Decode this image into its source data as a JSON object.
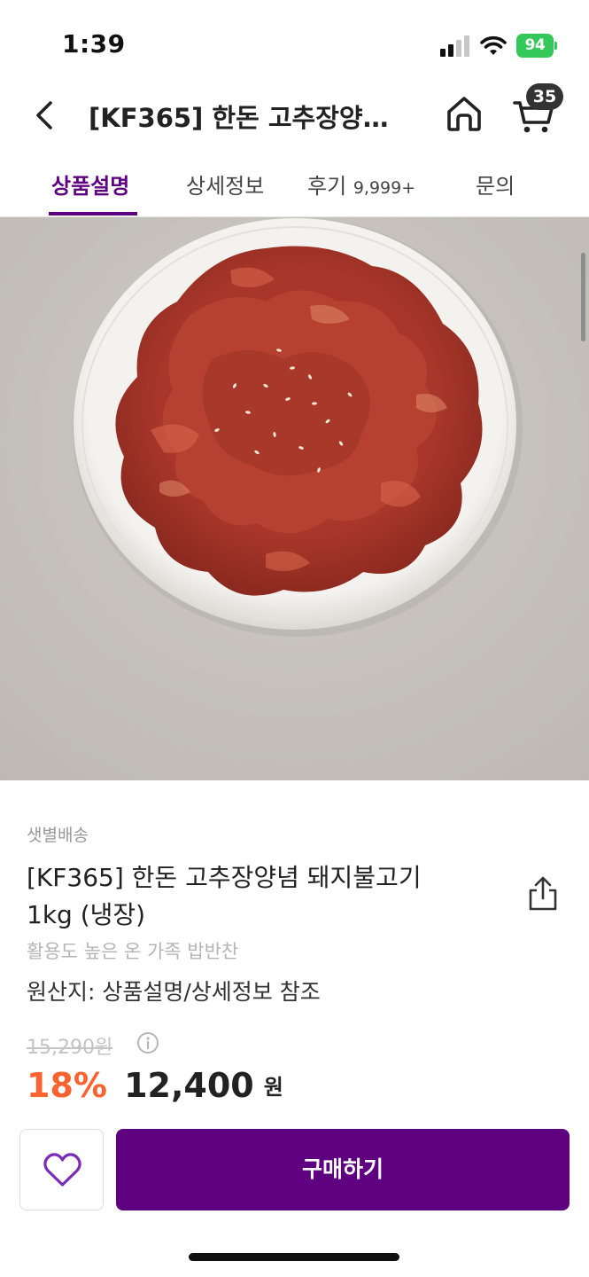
{
  "status_bar": {
    "time": "1:39",
    "battery": "94"
  },
  "header": {
    "title": "[KF365] 한돈 고추장양념 돼지불고기 1kg (냉장)",
    "cart_count": "35",
    "icons": [
      "chevron-left-icon",
      "home-icon",
      "cart-icon"
    ]
  },
  "tabs": [
    {
      "label": "상품설명",
      "count": "",
      "active": true
    },
    {
      "label": "상세정보",
      "count": "",
      "active": false
    },
    {
      "label": "후기",
      "count": "9,999+",
      "active": false
    },
    {
      "label": "문의",
      "count": "",
      "active": false
    }
  ],
  "product": {
    "delivery": "샛별배송",
    "name_line1": "[KF365] 한돈 고추장양념 돼지불고기",
    "name_line2": "1kg (냉장)",
    "subtitle": "활용도 높은 온 가족 밥반찬",
    "origin": "원산지: 상품설명/상세정보 참조",
    "original_price": "15,290원",
    "discount": "18%",
    "price": "12,400",
    "currency": "원"
  },
  "bottom_bar": {
    "buy_label": "구매하기"
  },
  "colors": {
    "brand": "#5f0080",
    "discount": "#fa622f",
    "battery": "#34c759"
  }
}
